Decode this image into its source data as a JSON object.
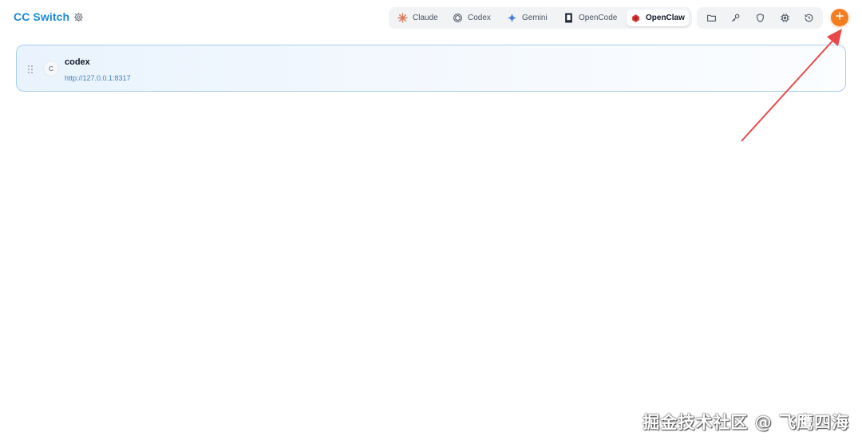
{
  "header": {
    "title": "CC Switch",
    "settings_icon": "gear-icon"
  },
  "app_tabs": [
    {
      "label": "Claude",
      "icon": "claude-icon",
      "active": false
    },
    {
      "label": "Codex",
      "icon": "codex-icon",
      "active": false
    },
    {
      "label": "Gemini",
      "icon": "gemini-icon",
      "active": false
    },
    {
      "label": "OpenCode",
      "icon": "opencode-icon",
      "active": false
    },
    {
      "label": "OpenClaw",
      "icon": "openclaw-icon",
      "active": true
    }
  ],
  "toolbar": {
    "icons": [
      "folder-icon",
      "key-icon",
      "shield-icon",
      "chip-icon",
      "history-icon"
    ],
    "add_icon": "plus-icon"
  },
  "providers": [
    {
      "avatar_letter": "C",
      "name": "codex",
      "url": "http://127.0.0.1:8317"
    }
  ],
  "watermark": "掘金技术社区 @ 飞鹰四海",
  "colors": {
    "brand": "#1a8ad8",
    "accent_add": "#f47d20",
    "card_border": "#a9cdee",
    "annotation_arrow": "#e84a4a"
  }
}
